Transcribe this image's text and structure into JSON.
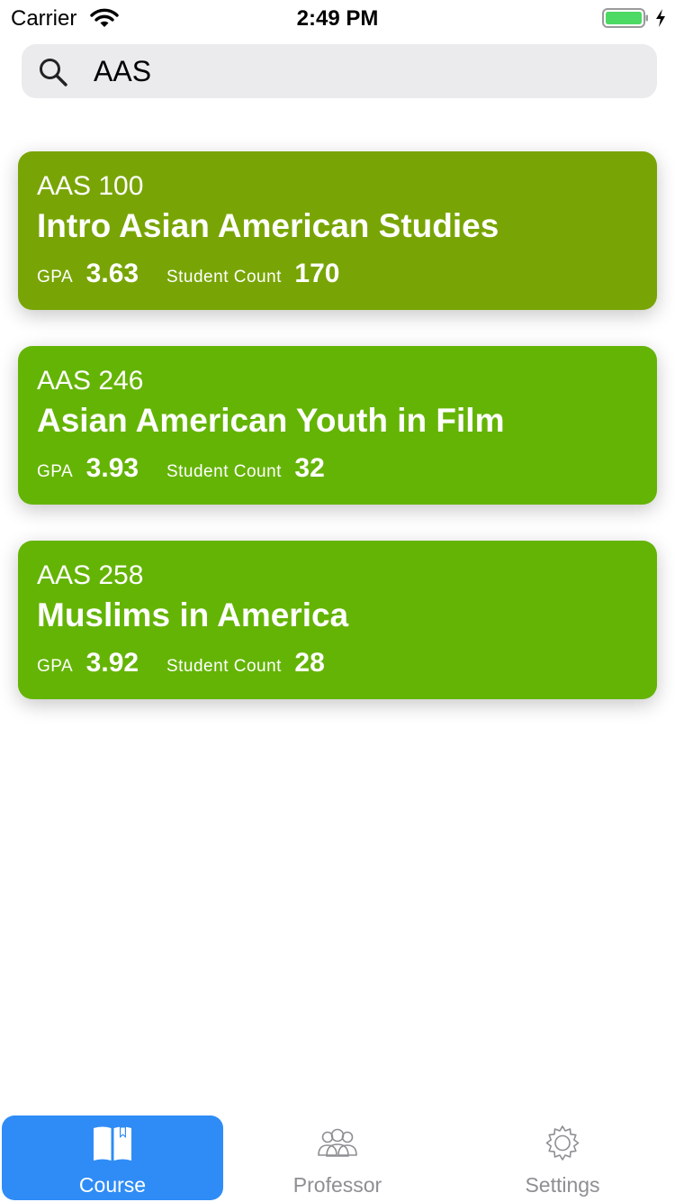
{
  "status_bar": {
    "carrier": "Carrier",
    "time": "2:49 PM",
    "battery_color": "#4cd964"
  },
  "search": {
    "value": "AAS",
    "icon": "search-icon"
  },
  "courses": [
    {
      "code": "AAS 100",
      "title": "Intro Asian American Studies",
      "gpa_label": "GPA",
      "gpa": "3.63",
      "count_label": "Student Count",
      "count": "170",
      "color": "#78a505"
    },
    {
      "code": "AAS 246",
      "title": "Asian American Youth in Film",
      "gpa_label": "GPA",
      "gpa": "3.93",
      "count_label": "Student Count",
      "count": "32",
      "color": "#64b405"
    },
    {
      "code": "AAS 258",
      "title": "Muslims in America",
      "gpa_label": "GPA",
      "gpa": "3.92",
      "count_label": "Student Count",
      "count": "28",
      "color": "#64b405"
    }
  ],
  "tabs": [
    {
      "label": "Course",
      "icon": "book-icon",
      "active": true
    },
    {
      "label": "Professor",
      "icon": "people-icon",
      "active": false
    },
    {
      "label": "Settings",
      "icon": "gear-icon",
      "active": false
    }
  ],
  "colors": {
    "accent": "#2f8cf6",
    "inactive_tab": "#8e8e93"
  }
}
